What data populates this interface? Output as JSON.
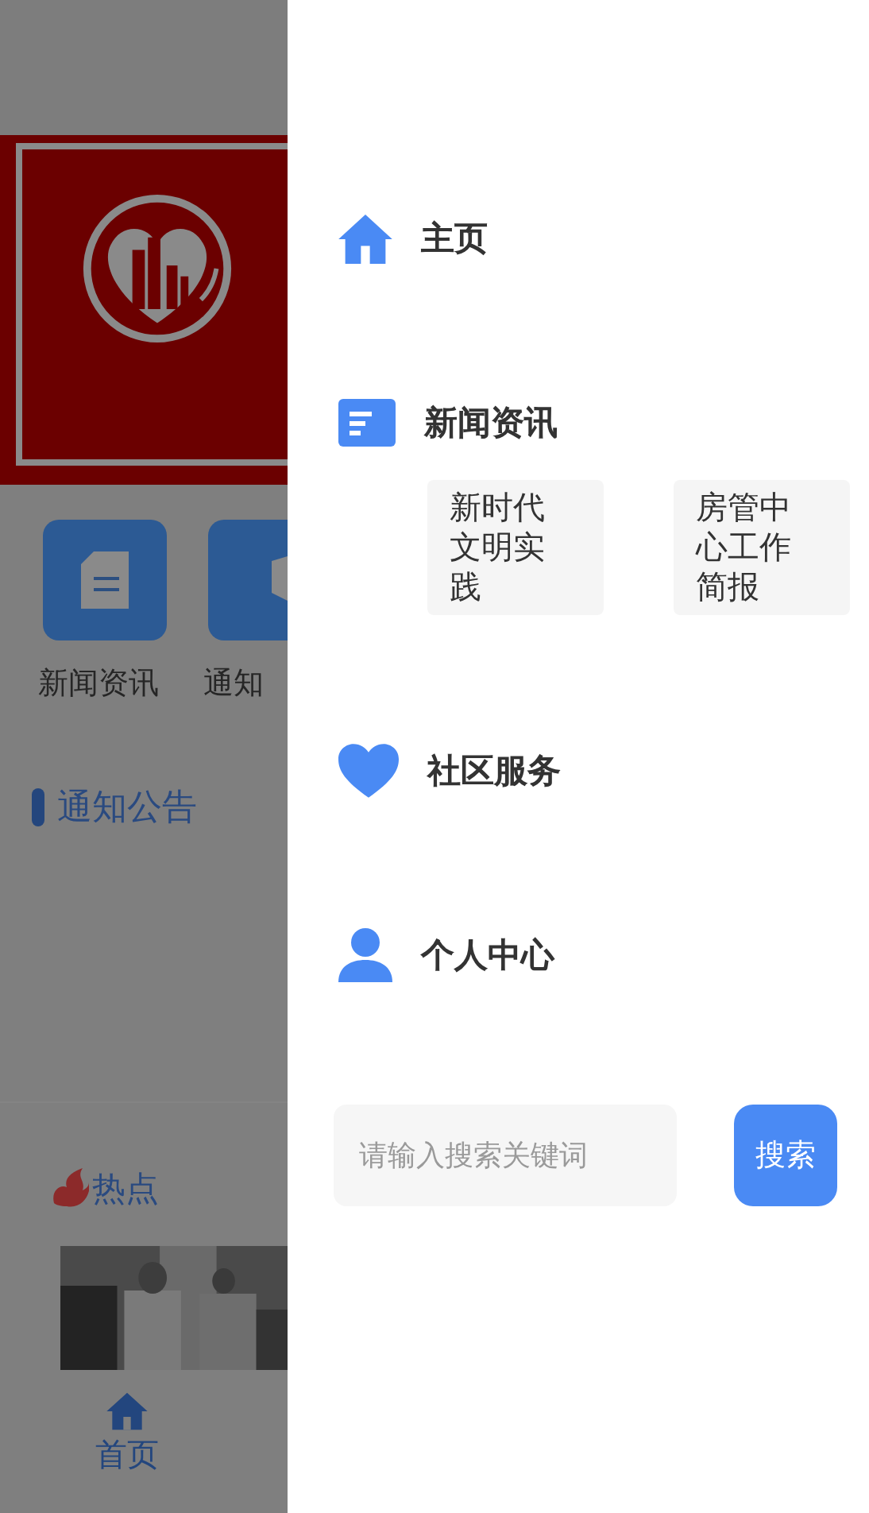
{
  "background_page": {
    "tiles": [
      {
        "kind": "document",
        "label": "新闻资讯"
      },
      {
        "kind": "megaphone",
        "label": "通知"
      }
    ],
    "section_title": "通知公告",
    "hot_title": "热点",
    "tab_bar": [
      {
        "label": "首页",
        "selected": true
      }
    ]
  },
  "drawer": {
    "menu": [
      {
        "kind": "home",
        "label": "主页"
      },
      {
        "kind": "news",
        "label": "新闻资讯",
        "children": [
          {
            "label": "新时代文明实践"
          },
          {
            "label": "房管中心工作简报"
          }
        ]
      },
      {
        "kind": "heart",
        "label": "社区服务"
      },
      {
        "kind": "person",
        "label": "个人中心"
      }
    ],
    "search": {
      "placeholder": "请输入搜索关键词",
      "button": "搜索"
    }
  }
}
